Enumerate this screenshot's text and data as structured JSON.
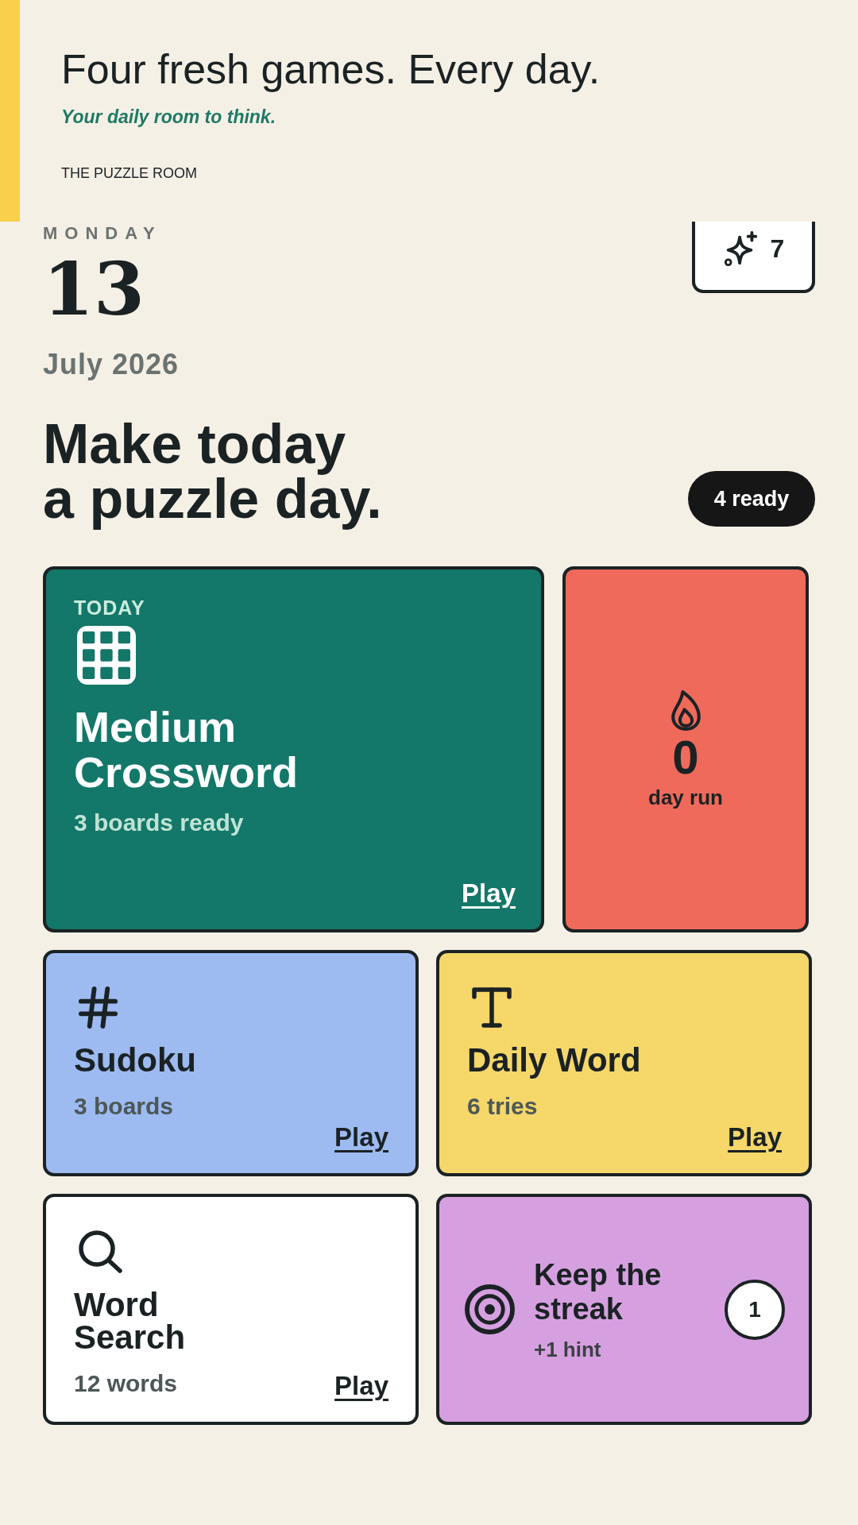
{
  "header": {
    "title": "Four fresh games. Every day.",
    "tagline": "Your daily room to think.",
    "brand": "THE PUZZLE ROOM"
  },
  "date": {
    "weekday": "MONDAY",
    "day": "13",
    "month_year": "July 2026"
  },
  "hints_badge": {
    "count": "7"
  },
  "headline": {
    "text": "Make today\na puzzle day.",
    "ready": "4 ready"
  },
  "featured": {
    "eyebrow": "TODAY",
    "title": "Medium\nCrossword",
    "subtitle": "3 boards ready",
    "action": "Play"
  },
  "streak": {
    "count": "0",
    "label": "day run"
  },
  "games": [
    {
      "kind": "numbers",
      "title": "Sudoku",
      "detail": "3 boards",
      "action": "Play",
      "color": "#9dbbf1"
    },
    {
      "kind": "letters",
      "title": "Daily Word",
      "detail": "6 tries",
      "action": "Play",
      "color": "#f5d76a"
    },
    {
      "kind": "search",
      "title": "Word\nSearch",
      "detail": "12 words",
      "action": "Play",
      "color": "#ffffff"
    }
  ],
  "bonus": {
    "title": "Keep the streak",
    "reward": "+1 hint",
    "count": "1"
  }
}
